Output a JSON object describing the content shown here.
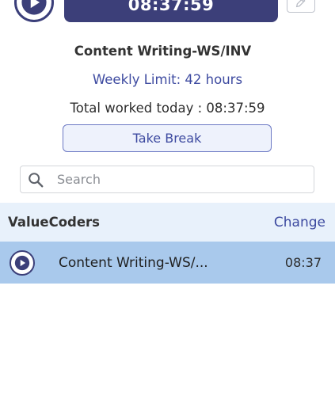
{
  "timer": {
    "display": "08:37:59"
  },
  "project": {
    "title": "Content Writing-WS/INV",
    "weekly_limit": "Weekly Limit: 42 hours",
    "total_worked": "Total worked today : 08:37:59"
  },
  "actions": {
    "take_break_label": "Take Break"
  },
  "search": {
    "placeholder": "Search",
    "value": ""
  },
  "organization": {
    "name": "ValueCoders",
    "change_label": "Change"
  },
  "projects": [
    {
      "name": "Content Writing-WS/...",
      "time": "08:37",
      "active": true
    }
  ],
  "colors": {
    "accent": "#3c3f79",
    "link": "#3d4aa0",
    "org_row_bg": "#e8f1fb",
    "active_row_bg": "#a9c9ec"
  },
  "icons": {
    "top_play": "play-circle-icon",
    "edit": "edit-pencil-icon",
    "search": "search-icon",
    "row_play": "play-circle-icon"
  }
}
